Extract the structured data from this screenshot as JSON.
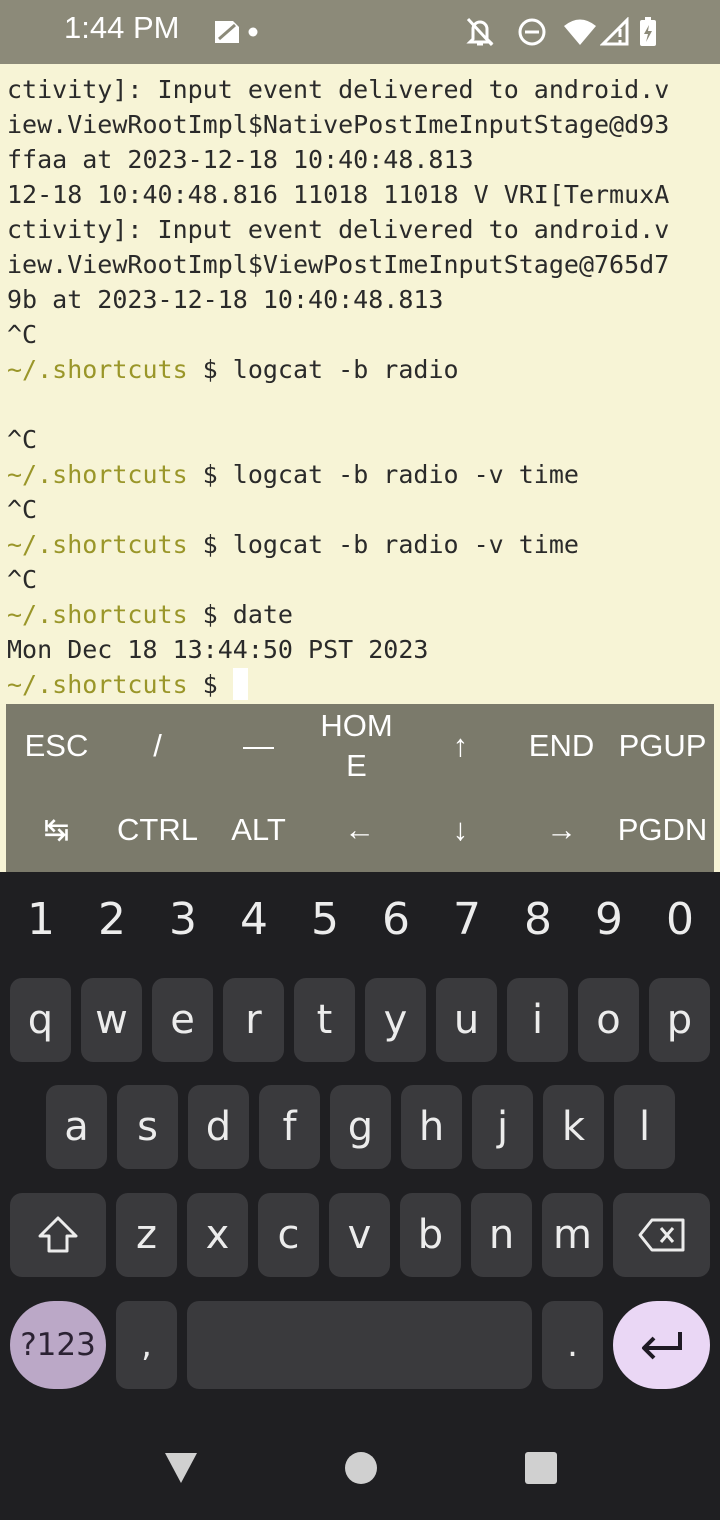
{
  "status_bar": {
    "time": "1:44 PM",
    "icons": [
      "sim-card-icon",
      "dot-icon",
      "notifications-off-icon",
      "do-not-disturb-icon",
      "wifi-icon",
      "cell-signal-icon",
      "battery-charging-icon"
    ]
  },
  "terminal": {
    "lines": [
      {
        "text": "ctivity]: Input event delivered to android.v"
      },
      {
        "text": "iew.ViewRootImpl$NativePostImeInputStage@d93"
      },
      {
        "text": "ffaa at 2023-12-18 10:40:48.813"
      },
      {
        "text": "12-18 10:40:48.816 11018 11018 V VRI[TermuxA"
      },
      {
        "text": "ctivity]: Input event delivered to android.v"
      },
      {
        "text": "iew.ViewRootImpl$ViewPostImeInputStage@765d7"
      },
      {
        "text": "9b at 2023-12-18 10:40:48.813"
      },
      {
        "text": "^C"
      },
      {
        "prompt": "~/.shortcuts",
        "command": " $ logcat -b radio"
      },
      {
        "text": ""
      },
      {
        "text": "^C"
      },
      {
        "prompt": "~/.shortcuts",
        "command": " $ logcat -b radio -v time"
      },
      {
        "text": "^C"
      },
      {
        "prompt": "~/.shortcuts",
        "command": " $ logcat -b radio -v time"
      },
      {
        "text": "^C"
      },
      {
        "prompt": "~/.shortcuts",
        "command": " $ date"
      },
      {
        "text": "Mon Dec 18 13:44:50 PST 2023"
      },
      {
        "prompt": "~/.shortcuts",
        "command": " $ "
      }
    ]
  },
  "extra_keys": {
    "row1": [
      "ESC",
      "/",
      "—",
      "HOM E",
      "↑",
      "END",
      "PGUP"
    ],
    "row2": [
      "↹",
      "CTRL",
      "ALT",
      "←",
      "↓",
      "→",
      "PGDN"
    ]
  },
  "keyboard": {
    "numbers": [
      "1",
      "2",
      "3",
      "4",
      "5",
      "6",
      "7",
      "8",
      "9",
      "0"
    ],
    "row1": [
      "q",
      "w",
      "e",
      "r",
      "t",
      "y",
      "u",
      "i",
      "o",
      "p"
    ],
    "row2": [
      "a",
      "s",
      "d",
      "f",
      "g",
      "h",
      "j",
      "k",
      "l"
    ],
    "row3": [
      "z",
      "x",
      "c",
      "v",
      "b",
      "n",
      "m"
    ],
    "symbols_label": "?123",
    "comma": ",",
    "period": ".",
    "colors": {
      "accent": "#ead7f5",
      "symbols_key": "#bba8c7",
      "key": "#3a3a3d",
      "background": "#1f1f22"
    }
  },
  "colors": {
    "terminal_bg": "#f7f4d6",
    "prompt": "#9a9629",
    "status_bar": "#8c8a79",
    "extra_keys_bg": "#7b7a6b"
  }
}
